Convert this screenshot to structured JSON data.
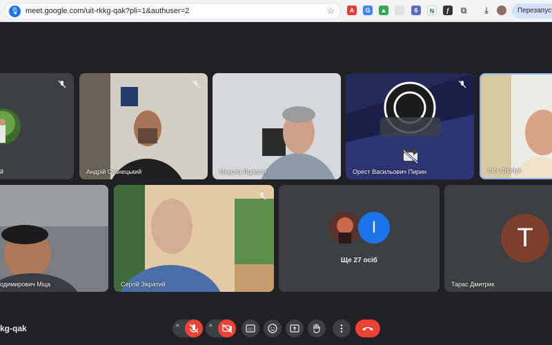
{
  "browser": {
    "url": "meet.google.com/uit-rkkg-qak?pli=1&authuser=2",
    "restart_label": "Перезапустити"
  },
  "participants": [
    {
      "name": "й",
      "muted": true
    },
    {
      "name": "Андрій Станецький",
      "muted": true
    },
    {
      "name": "Микола Яцишин",
      "muted": false
    },
    {
      "name": "Орест Васильович Пирин",
      "muted": true
    },
    {
      "name": "Ihor Chudyk",
      "muted": false
    },
    {
      "name": "одимирович Міца",
      "muted": false
    },
    {
      "name": "Сергій Зікратий",
      "muted": true
    },
    {
      "name": "Тарас Дмитрик",
      "muted": false
    }
  ],
  "others": {
    "label": "Ще 27 осіб",
    "avatar_letter": "I"
  },
  "taras_avatar_letter": "T",
  "meeting_code": "kg-qak",
  "colors": {
    "background": "#202124",
    "tile": "#3c4043",
    "danger": "#ea4335",
    "accent": "#1a73e8"
  },
  "icons": {
    "mic": "microphone-off-icon",
    "camera": "camera-off-icon",
    "captions": "closed-captions-icon",
    "emoji": "emoji-icon",
    "present": "present-screen-icon",
    "hand": "raise-hand-icon",
    "more": "more-options-icon",
    "hangup": "hang-up-icon"
  }
}
